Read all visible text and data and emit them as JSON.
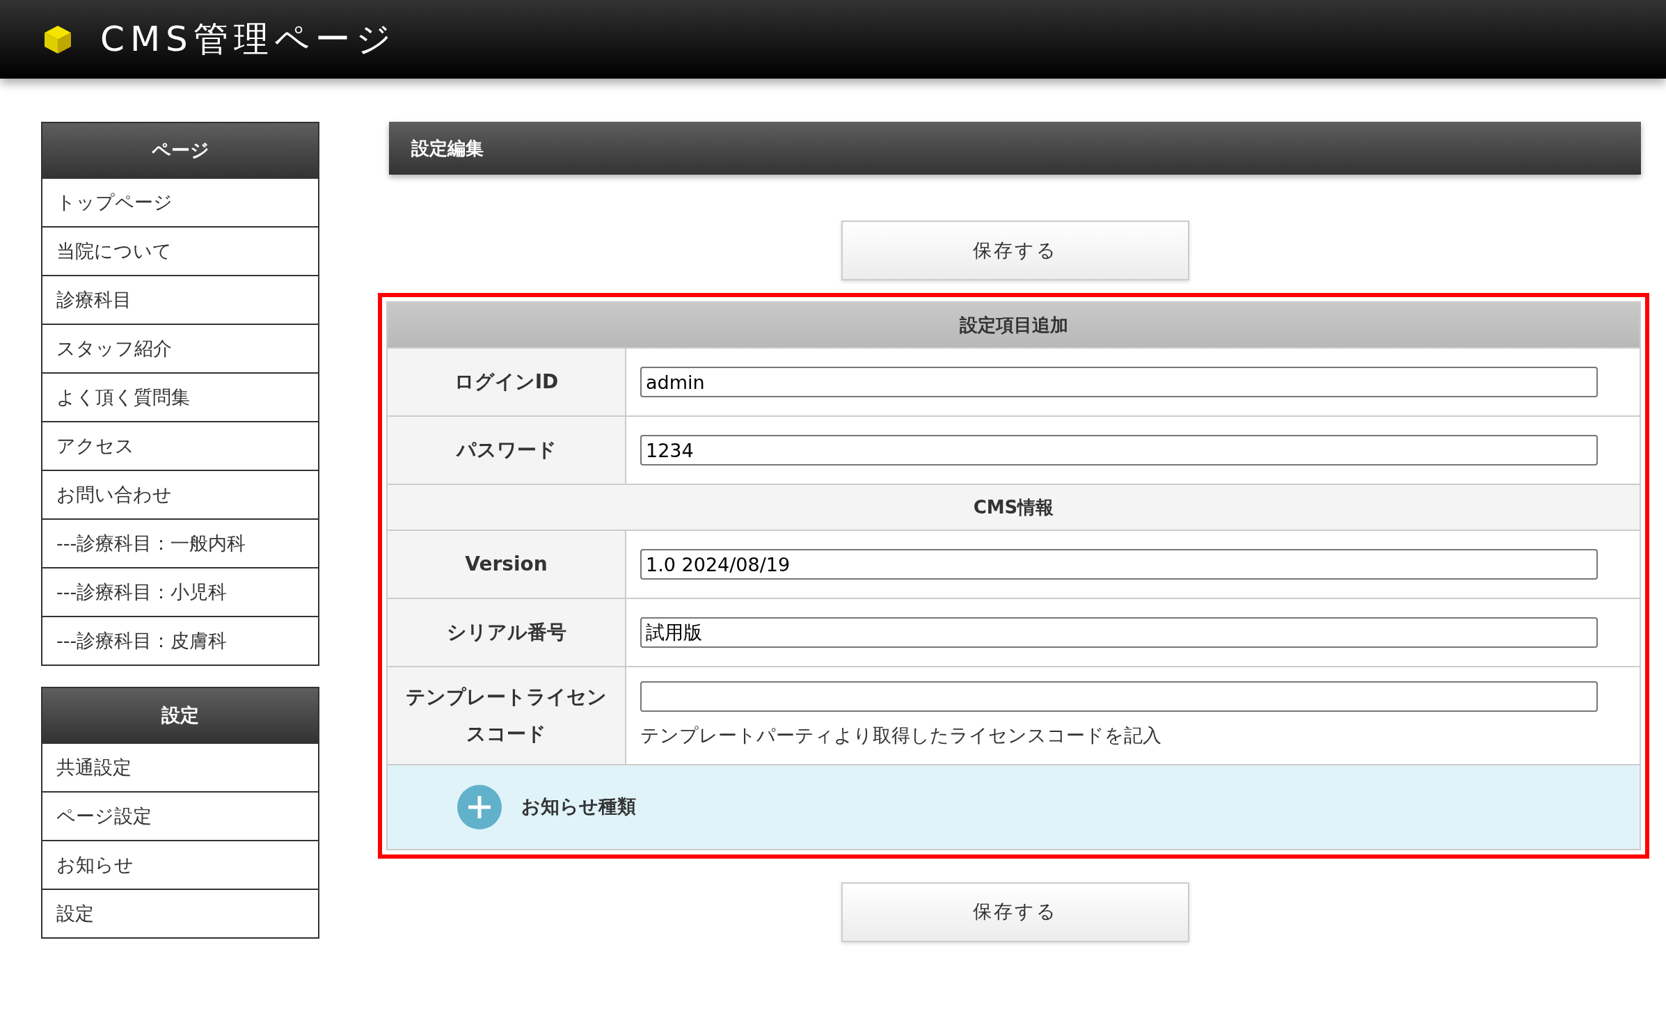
{
  "header": {
    "title": "CMS管理ページ"
  },
  "sidebar": [
    {
      "title": "ページ",
      "items": [
        "トップページ",
        "当院について",
        "診療科目",
        "スタッフ紹介",
        "よく頂く質問集",
        "アクセス",
        "お問い合わせ",
        "---診療科目：一般内科",
        "---診療科目：小児科",
        "---診療科目：皮膚科"
      ]
    },
    {
      "title": "設定",
      "items": [
        "共通設定",
        "ページ設定",
        "お知らせ",
        "設定"
      ]
    }
  ],
  "main": {
    "title": "設定編集",
    "save_button_top": "保存する",
    "form_sections": [
      {
        "heading": "設定項目追加",
        "rows": [
          {
            "label": "ログインID",
            "value": "admin"
          },
          {
            "label": "パスワード",
            "value": "1234"
          }
        ]
      },
      {
        "heading": "CMS情報",
        "rows": [
          {
            "label": "Version",
            "value": "1.0 2024/08/19"
          },
          {
            "label": "シリアル番号",
            "value": "試用版"
          },
          {
            "label": "テンプレートライセンスコード",
            "value": "",
            "note": "テンプレートパーティより取得したライセンスコードを記入"
          }
        ]
      }
    ],
    "add_item": {
      "label": "お知らせ種類"
    },
    "save_button_bottom": "保存する"
  }
}
